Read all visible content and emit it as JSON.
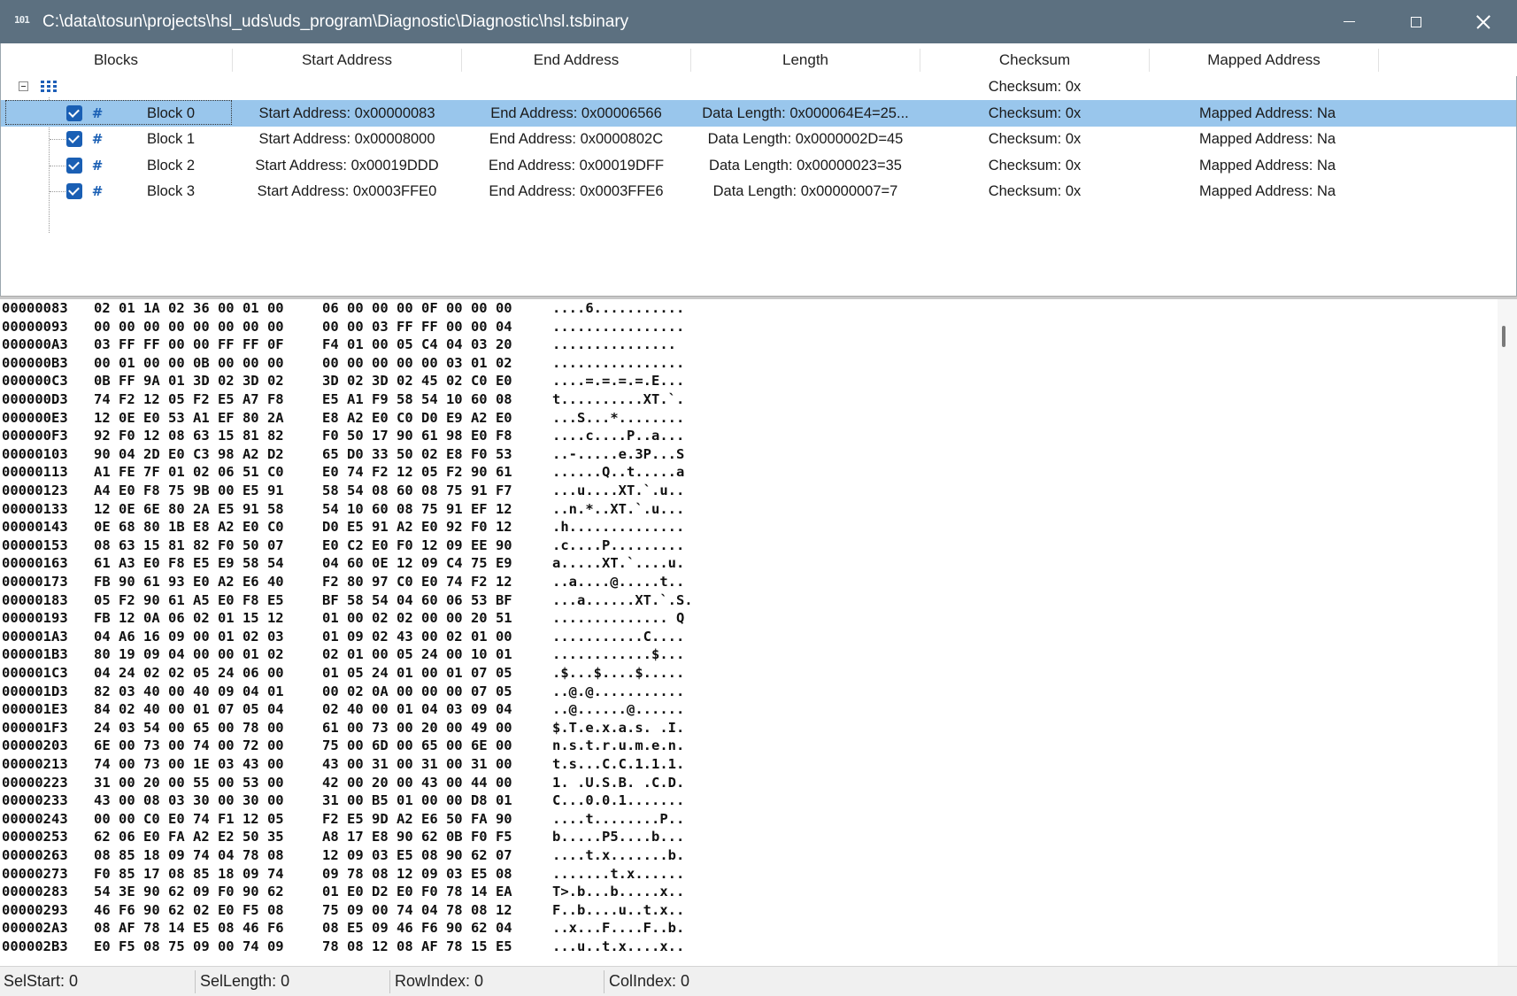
{
  "window": {
    "icon_glyph": "101",
    "title": "C:\\data\\tosun\\projects\\hsl_uds\\uds_program\\Diagnostic\\Diagnostic\\hsl.tsbinary"
  },
  "grid": {
    "columns": [
      "Blocks",
      "Start Address",
      "End Address",
      "Length",
      "Checksum",
      "Mapped Address"
    ],
    "root": {
      "checksum": "Checksum: 0x"
    },
    "blocks": [
      {
        "name": "Block 0",
        "start": "Start Address: 0x00000083",
        "end": "End Address: 0x00006566",
        "length": "Data Length: 0x000064E4=25...",
        "checksum": "Checksum: 0x",
        "mapped": "Mapped Address: Na",
        "checked": true,
        "selected": true
      },
      {
        "name": "Block 1",
        "start": "Start Address: 0x00008000",
        "end": "End Address: 0x0000802C",
        "length": "Data Length: 0x0000002D=45",
        "checksum": "Checksum: 0x",
        "mapped": "Mapped Address: Na",
        "checked": true,
        "selected": false
      },
      {
        "name": "Block 2",
        "start": "Start Address: 0x00019DDD",
        "end": "End Address: 0x00019DFF",
        "length": "Data Length: 0x00000023=35",
        "checksum": "Checksum: 0x",
        "mapped": "Mapped Address: Na",
        "checked": true,
        "selected": false
      },
      {
        "name": "Block 3",
        "start": "Start Address: 0x0003FFE0",
        "end": "End Address: 0x0003FFE6",
        "length": "Data Length: 0x00000007=7",
        "checksum": "Checksum: 0x",
        "mapped": "Mapped Address: Na",
        "checked": true,
        "selected": false
      }
    ]
  },
  "hex": {
    "rows": [
      {
        "addr": "00000083",
        "b1": "02 01 1A 02 36 00 01 00",
        "b2": "06 00 00 00 0F 00 00 00",
        "ascii": "....6..........."
      },
      {
        "addr": "00000093",
        "b1": "00 00 00 00 00 00 00 00",
        "b2": "00 00 03 FF FF 00 00 04",
        "ascii": "................"
      },
      {
        "addr": "000000A3",
        "b1": "03 FF FF 00 00 FF FF 0F",
        "b2": "F4 01 00 05 C4 04 03 20",
        "ascii": "..............."
      },
      {
        "addr": "000000B3",
        "b1": "00 01 00 00 0B 00 00 00",
        "b2": "00 00 00 00 00 03 01 02",
        "ascii": "................"
      },
      {
        "addr": "000000C3",
        "b1": "0B FF 9A 01 3D 02 3D 02",
        "b2": "3D 02 3D 02 45 02 C0 E0",
        "ascii": "....=.=.=.=.E..."
      },
      {
        "addr": "000000D3",
        "b1": "74 F2 12 05 F2 E5 A7 F8",
        "b2": "E5 A1 F9 58 54 10 60 08",
        "ascii": "t..........XT.`."
      },
      {
        "addr": "000000E3",
        "b1": "12 0E E0 53 A1 EF 80 2A",
        "b2": "E8 A2 E0 C0 D0 E9 A2 E0",
        "ascii": "...S...*........"
      },
      {
        "addr": "000000F3",
        "b1": "92 F0 12 08 63 15 81 82",
        "b2": "F0 50 17 90 61 98 E0 F8",
        "ascii": "....c....P..a..."
      },
      {
        "addr": "00000103",
        "b1": "90 04 2D E0 C3 98 A2 D2",
        "b2": "65 D0 33 50 02 E8 F0 53",
        "ascii": "..-.....e.3P...S"
      },
      {
        "addr": "00000113",
        "b1": "A1 FE 7F 01 02 06 51 C0",
        "b2": "E0 74 F2 12 05 F2 90 61",
        "ascii": "......Q..t.....a"
      },
      {
        "addr": "00000123",
        "b1": "A4 E0 F8 75 9B 00 E5 91",
        "b2": "58 54 08 60 08 75 91 F7",
        "ascii": "...u....XT.`.u.."
      },
      {
        "addr": "00000133",
        "b1": "12 0E 6E 80 2A E5 91 58",
        "b2": "54 10 60 08 75 91 EF 12",
        "ascii": "..n.*..XT.`.u..."
      },
      {
        "addr": "00000143",
        "b1": "0E 68 80 1B E8 A2 E0 C0",
        "b2": "D0 E5 91 A2 E0 92 F0 12",
        "ascii": ".h.............."
      },
      {
        "addr": "00000153",
        "b1": "08 63 15 81 82 F0 50 07",
        "b2": "E0 C2 E0 F0 12 09 EE 90",
        "ascii": ".c....P........."
      },
      {
        "addr": "00000163",
        "b1": "61 A3 E0 F8 E5 E9 58 54",
        "b2": "04 60 0E 12 09 C4 75 E9",
        "ascii": "a.....XT.`....u."
      },
      {
        "addr": "00000173",
        "b1": "FB 90 61 93 E0 A2 E6 40",
        "b2": "F2 80 97 C0 E0 74 F2 12",
        "ascii": "..a....@.....t.."
      },
      {
        "addr": "00000183",
        "b1": "05 F2 90 61 A5 E0 F8 E5",
        "b2": "BF 58 54 04 60 06 53 BF",
        "ascii": "...a......XT.`.S."
      },
      {
        "addr": "00000193",
        "b1": "FB 12 0A 06 02 01 15 12",
        "b2": "01 00 02 02 00 00 20 51",
        "ascii": ".............. Q"
      },
      {
        "addr": "000001A3",
        "b1": "04 A6 16 09 00 01 02 03",
        "b2": "01 09 02 43 00 02 01 00",
        "ascii": "...........C...."
      },
      {
        "addr": "000001B3",
        "b1": "80 19 09 04 00 00 01 02",
        "b2": "02 01 00 05 24 00 10 01",
        "ascii": "............$..."
      },
      {
        "addr": "000001C3",
        "b1": "04 24 02 02 05 24 06 00",
        "b2": "01 05 24 01 00 01 07 05",
        "ascii": ".$...$....$....."
      },
      {
        "addr": "000001D3",
        "b1": "82 03 40 00 40 09 04 01",
        "b2": "00 02 0A 00 00 00 07 05",
        "ascii": "..@.@..........."
      },
      {
        "addr": "000001E3",
        "b1": "84 02 40 00 01 07 05 04",
        "b2": "02 40 00 01 04 03 09 04",
        "ascii": "..@......@......"
      },
      {
        "addr": "000001F3",
        "b1": "24 03 54 00 65 00 78 00",
        "b2": "61 00 73 00 20 00 49 00",
        "ascii": "$.T.e.x.a.s. .I."
      },
      {
        "addr": "00000203",
        "b1": "6E 00 73 00 74 00 72 00",
        "b2": "75 00 6D 00 65 00 6E 00",
        "ascii": "n.s.t.r.u.m.e.n."
      },
      {
        "addr": "00000213",
        "b1": "74 00 73 00 1E 03 43 00",
        "b2": "43 00 31 00 31 00 31 00",
        "ascii": "t.s...C.C.1.1.1."
      },
      {
        "addr": "00000223",
        "b1": "31 00 20 00 55 00 53 00",
        "b2": "42 00 20 00 43 00 44 00",
        "ascii": "1. .U.S.B. .C.D."
      },
      {
        "addr": "00000233",
        "b1": "43 00 08 03 30 00 30 00",
        "b2": "31 00 B5 01 00 00 D8 01",
        "ascii": "C...0.0.1......."
      },
      {
        "addr": "00000243",
        "b1": "00 00 C0 E0 74 F1 12 05",
        "b2": "F2 E5 9D A2 E6 50 FA 90",
        "ascii": "....t........P.."
      },
      {
        "addr": "00000253",
        "b1": "62 06 E0 FA A2 E2 50 35",
        "b2": "A8 17 E8 90 62 0B F0 F5",
        "ascii": "b.....P5....b..."
      },
      {
        "addr": "00000263",
        "b1": "08 85 18 09 74 04 78 08",
        "b2": "12 09 03 E5 08 90 62 07",
        "ascii": "....t.x.......b."
      },
      {
        "addr": "00000273",
        "b1": "F0 85 17 08 85 18 09 74",
        "b2": "09 78 08 12 09 03 E5 08",
        "ascii": ".......t.x......"
      },
      {
        "addr": "00000283",
        "b1": "54 3E 90 62 09 F0 90 62",
        "b2": "01 E0 D2 E0 F0 78 14 EA",
        "ascii": "T>.b...b.....x.."
      },
      {
        "addr": "00000293",
        "b1": "46 F6 90 62 02 E0 F5 08",
        "b2": "75 09 00 74 04 78 08 12",
        "ascii": "F..b....u..t.x.."
      },
      {
        "addr": "000002A3",
        "b1": "08 AF 78 14 E5 08 46 F6",
        "b2": "08 E5 09 46 F6 90 62 04",
        "ascii": "..x...F....F..b."
      },
      {
        "addr": "000002B3",
        "b1": "E0 F5 08 75 09 00 74 09",
        "b2": "78 08 12 08 AF 78 15 E5",
        "ascii": "...u..t.x....x.."
      }
    ]
  },
  "status": {
    "selstart": "SelStart: 0",
    "sellength": "SelLength: 0",
    "rowindex": "RowIndex: 0",
    "colindex": "ColIndex: 0"
  }
}
